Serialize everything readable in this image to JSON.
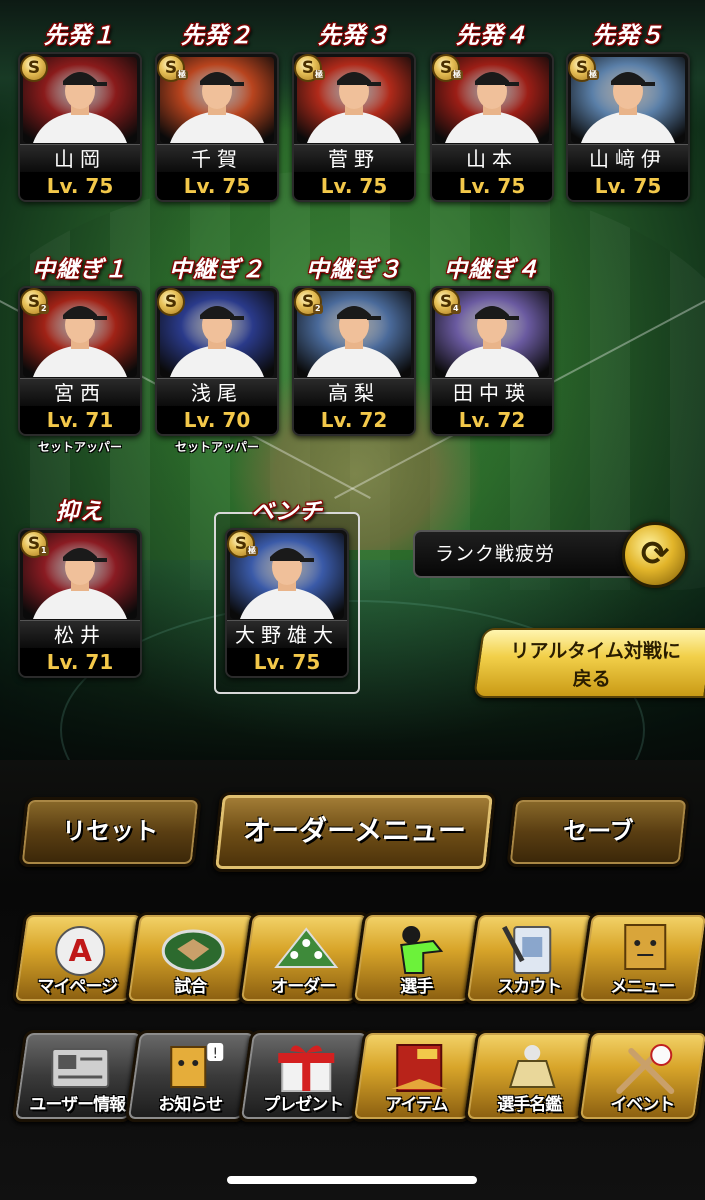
{
  "pitchers": {
    "starters": [
      {
        "pos": "先発１",
        "name": "山岡",
        "lv": "Lv. 75",
        "badge": "S",
        "badge_sub": "",
        "bg": "#8a1b1b"
      },
      {
        "pos": "先発２",
        "name": "千賀",
        "lv": "Lv. 75",
        "badge": "S",
        "badge_sub": "極",
        "bg": "#b8441e"
      },
      {
        "pos": "先発３",
        "name": "菅野",
        "lv": "Lv. 75",
        "badge": "S",
        "badge_sub": "極",
        "bg": "#b02a1a"
      },
      {
        "pos": "先発４",
        "name": "山本",
        "lv": "Lv. 75",
        "badge": "S",
        "badge_sub": "極",
        "bg": "#9c1e16"
      },
      {
        "pos": "先発５",
        "name": "山﨑伊",
        "lv": "Lv. 75",
        "badge": "S",
        "badge_sub": "極",
        "bg": "#5a7fa8"
      }
    ],
    "relievers": [
      {
        "pos": "中継ぎ１",
        "name": "宮西",
        "lv": "Lv. 71",
        "badge": "S",
        "badge_sub": "2",
        "role": "セットアッパー",
        "bg": "#a02216"
      },
      {
        "pos": "中継ぎ２",
        "name": "浅尾",
        "lv": "Lv. 70",
        "badge": "S",
        "badge_sub": "",
        "role": "セットアッパー",
        "bg": "#2a3a8a"
      },
      {
        "pos": "中継ぎ３",
        "name": "高梨",
        "lv": "Lv. 72",
        "badge": "S",
        "badge_sub": "2",
        "role": "",
        "bg": "#4a6a9a"
      },
      {
        "pos": "中継ぎ４",
        "name": "田中瑛",
        "lv": "Lv. 72",
        "badge": "S",
        "badge_sub": "4",
        "role": "",
        "bg": "#6a5aa0"
      }
    ],
    "closer": {
      "pos": "抑え",
      "name": "松井",
      "lv": "Lv. 71",
      "badge": "S",
      "badge_sub": "1",
      "bg": "#8a1b22"
    },
    "bench": {
      "pos": "ベンチ",
      "name": "大野雄大",
      "lv": "Lv. 75",
      "badge": "S",
      "badge_sub": "極",
      "bg": "#3a5aa8"
    }
  },
  "controls": {
    "fatigue_label": "ランク戦疲労",
    "refresh_icon": "⟳",
    "realtime_line1": "リアルタイム対戦に",
    "realtime_line2": "戻る"
  },
  "order_bar": {
    "reset": "リセット",
    "order_menu": "オーダーメニュー",
    "save": "セーブ"
  },
  "nav_primary": [
    {
      "label": "マイページ",
      "icon": "mypage-icon"
    },
    {
      "label": "試合",
      "icon": "stadium-icon"
    },
    {
      "label": "オーダー",
      "icon": "order-field-icon"
    },
    {
      "label": "選手",
      "icon": "player-icon"
    },
    {
      "label": "スカウト",
      "icon": "scout-icon"
    },
    {
      "label": "メニュー",
      "icon": "menu-box-icon"
    }
  ],
  "nav_secondary": [
    {
      "label": "ユーザー情報",
      "icon": "user-card-icon"
    },
    {
      "label": "お知らせ",
      "icon": "notice-icon"
    },
    {
      "label": "プレゼント",
      "icon": "gift-icon"
    },
    {
      "label": "アイテム",
      "icon": "item-book-icon"
    },
    {
      "label": "選手名鑑",
      "icon": "player-book-icon"
    },
    {
      "label": "イベント",
      "icon": "event-bat-icon"
    }
  ]
}
